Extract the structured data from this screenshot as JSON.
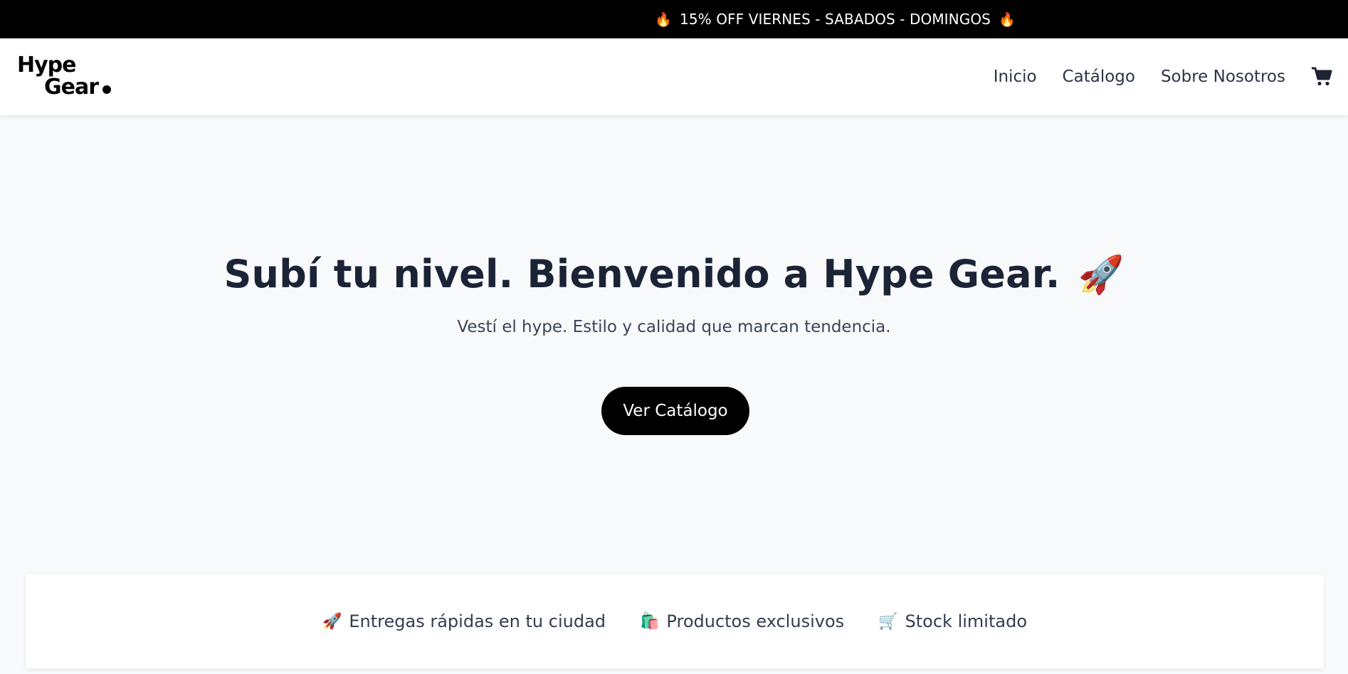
{
  "promo": {
    "left_icon": "fire-icon",
    "text": "15% OFF VIERNES - SABADOS - DOMINGOS",
    "right_icon": "fire-icon"
  },
  "header": {
    "logo_line1": "Hype",
    "logo_line2": "Gear",
    "nav": [
      {
        "label": "Inicio"
      },
      {
        "label": "Catálogo"
      },
      {
        "label": "Sobre Nosotros"
      }
    ],
    "cart_icon": "shopping-cart-icon"
  },
  "hero": {
    "title": "Subí tu nivel. Bienvenido a Hype Gear.",
    "title_icon": "rocket-icon",
    "subtitle": "Vestí el hype. Estilo y calidad que marcan tendencia.",
    "cta_label": "Ver Catálogo"
  },
  "features": [
    {
      "icon": "rocket-icon",
      "label": "Entregas rápidas en tu ciudad"
    },
    {
      "icon": "shopping-bag-icon",
      "label": "Productos exclusivos"
    },
    {
      "icon": "shopping-cart-icon",
      "label": "Stock limitado"
    }
  ],
  "colors": {
    "topbar": "#000000",
    "navbar": "#ffffff",
    "page_bg": "#f8f9fb",
    "heading": "#1b2436",
    "button": "#000000"
  }
}
